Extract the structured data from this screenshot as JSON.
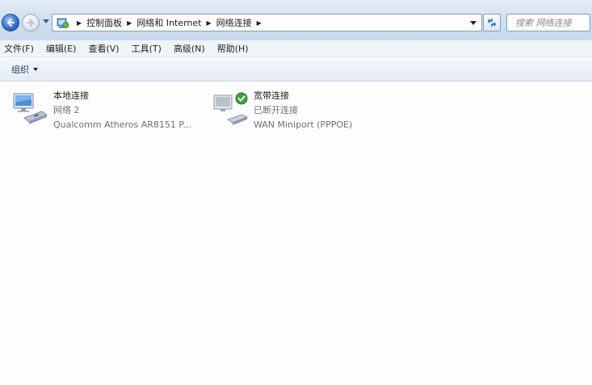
{
  "address_bar": {
    "crumbs": [
      "控制面板",
      "网络和 Internet",
      "网络连接"
    ],
    "search_placeholder": "搜索 网络连接"
  },
  "menu": {
    "items": [
      "文件(F)",
      "编辑(E)",
      "查看(V)",
      "工具(T)",
      "高级(N)",
      "帮助(H)"
    ]
  },
  "command_bar": {
    "organize_label": "组织"
  },
  "connections": [
    {
      "name": "本地连接",
      "status": "网络  2",
      "device": "Qualcomm Atheros AR8151 P...",
      "icon": "network-adapter-icon"
    },
    {
      "name": "宽带连接",
      "status": "已断开连接",
      "device": "WAN Miniport (PPPOE)",
      "icon": "broadband-modem-icon"
    }
  ],
  "colors": {
    "titlebar_top": "#e4edf7",
    "titlebar_bottom": "#c7d9ed",
    "status_gray": "#707070",
    "check_green": "#3aa53a"
  }
}
